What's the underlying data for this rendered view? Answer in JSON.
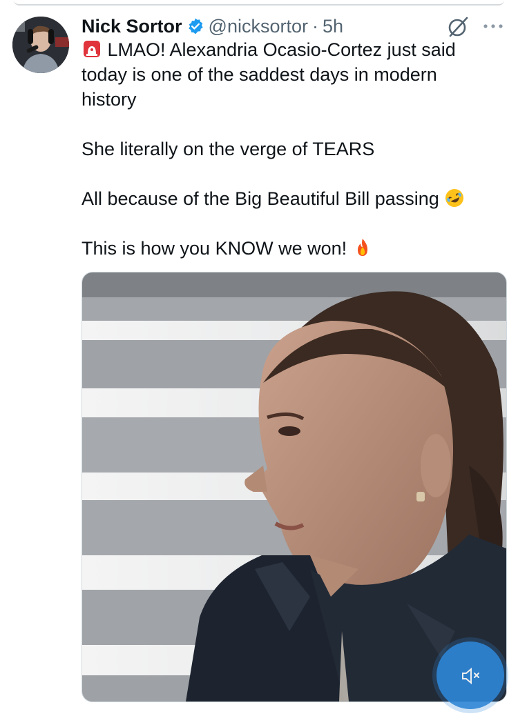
{
  "tweet": {
    "author_name": "Nick Sortor",
    "handle": "@nicksortor",
    "separator": "·",
    "time": "5h",
    "lines": [
      "LMAO! Alexandria Ocasio-Cortez just said today is one of the saddest days in modern history",
      "She literally on the verge of TEARS",
      "All because of the Big Beautiful Bill passing",
      "This is how you KNOW we won!"
    ]
  },
  "icons": {
    "verified": "verified-badge-icon",
    "grok": "grok-icon",
    "more": "more-options-icon",
    "siren": "police-light-emoji",
    "laugh": "rolling-laughing-emoji",
    "fire": "fire-emoji",
    "mute": "muted-speaker-icon"
  },
  "colors": {
    "verified": "#1d9bf0",
    "text": "#0f1419",
    "secondary": "#536471",
    "mute_button": "#2f86d6"
  }
}
